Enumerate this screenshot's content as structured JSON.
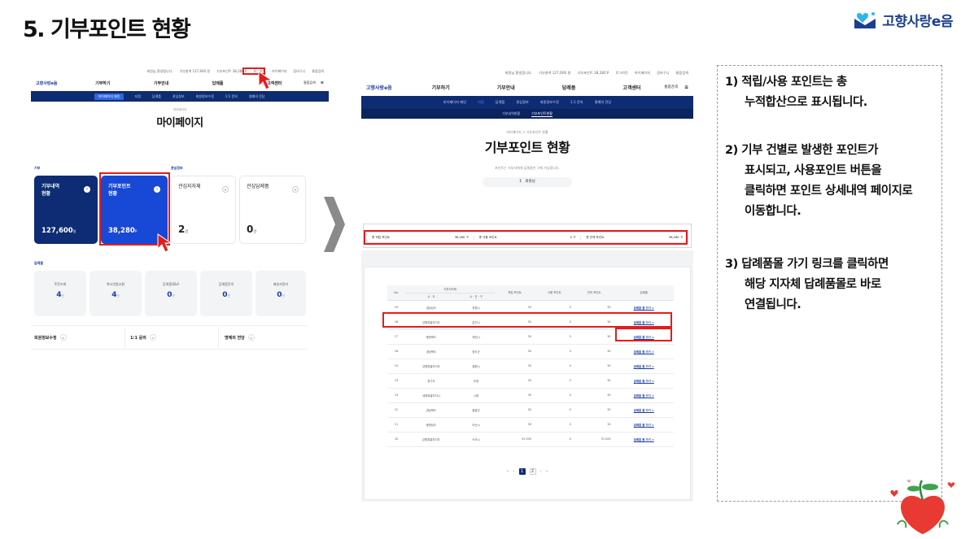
{
  "slide": {
    "title": "5. 기부포인트 현황",
    "brand": "고향사랑e음"
  },
  "left": {
    "util": [
      "회원님 환영합니다.",
      "기부총액 127,600 원",
      "기부포인트 38,280 P",
      "로그아웃",
      "마이페이지",
      "장바구니",
      "통합검색"
    ],
    "logo": "고향사랑e음",
    "menu": [
      "기부하기",
      "기부안내",
      "답례품",
      "고객센터"
    ],
    "search": "통합검색",
    "subnav": [
      "마이페이지 메인",
      "지정",
      "답례품",
      "관심정보",
      "회원정보수정",
      "1:1 문의",
      "명예의 전당"
    ],
    "crumb": "마이페이지",
    "title": "마이페이지",
    "sec_donation": "기부",
    "sec_interest": "관심정보",
    "sec_gift": "답례품",
    "cards": [
      {
        "label": "기부내역\n현황",
        "value": "127,600",
        "unit": "원"
      },
      {
        "label": "기부포인트\n현황",
        "value": "38,280",
        "unit": "P"
      },
      {
        "label": "관심지자체",
        "value": "2",
        "unit": "건"
      },
      {
        "label": "관심답례품",
        "value": "0",
        "unit": "건"
      }
    ],
    "minis": [
      {
        "label": "주문조회",
        "value": "4",
        "unit": "건"
      },
      {
        "label": "취소반품교환",
        "value": "4",
        "unit": "건"
      },
      {
        "label": "답례품Q&A",
        "value": "0",
        "unit": "건"
      },
      {
        "label": "답례품문의",
        "value": "0",
        "unit": "건"
      },
      {
        "label": "배송지관리",
        "value": "0",
        "unit": "건"
      }
    ],
    "links": [
      "회원정보수정",
      "1:1 문의",
      "명예의 전당"
    ]
  },
  "right": {
    "util": [
      "회원님 환영합니다.",
      "기부총액 127,600 원",
      "기부포인트 38,280 P",
      "로그아웃",
      "마이페이지",
      "장바구니",
      "통합검색"
    ],
    "logo": "고향사랑e음",
    "menu": [
      "기부하기",
      "기부안내",
      "답례품",
      "고객센터"
    ],
    "search": "통합검색",
    "subnav": [
      "마이페이지 메인",
      "지정",
      "답례품",
      "관심정보",
      "회원정보수정",
      "1:1 문의",
      "명예의 전당"
    ],
    "subnav2": [
      "기부내역현황",
      "기부포인트현황"
    ],
    "crumb": "마이페이지 > 기부포인트 현황",
    "title": "기부포인트 현황",
    "desc": "포인트는 기부자에게 답례품만 구매 가능합니다.",
    "user": "회원님",
    "summary": [
      {
        "label": "총 적립 포인트",
        "value": "38,280",
        "unit": "P"
      },
      {
        "label": "총 사용 포인트",
        "value": "0",
        "unit": "P"
      },
      {
        "label": "총 잔액 포인트",
        "value": "38,280",
        "unit": "P"
      }
    ],
    "table": {
      "h_no": "No.",
      "h_group": "기부지자체",
      "h_sido": "시 · 도",
      "h_sigungu": "시 · 군 · 구",
      "h_earn": "적립 포인트",
      "h_used": "사용 포인트",
      "h_bal": "잔여 포인트",
      "h_gift": "답례품",
      "go": "답례품 몰 가기 >",
      "rows": [
        [
          "19",
          "경상남도",
          "창원시",
          "30",
          "0",
          "30"
        ],
        [
          "18",
          "강원특별자치도",
          "춘천시",
          "30",
          "0",
          "30"
        ],
        [
          "17",
          "충청북도",
          "제천시",
          "30",
          "0",
          "30"
        ],
        [
          "16",
          "경상북도",
          "청도군",
          "30",
          "0",
          "30"
        ],
        [
          "15",
          "강원특별자치도",
          "철원시",
          "30",
          "0",
          "30"
        ],
        [
          "14",
          "경기도",
          "도청",
          "30",
          "0",
          "30"
        ],
        [
          "13",
          "세종특별자치시",
          "시청",
          "30",
          "0",
          "30"
        ],
        [
          "12",
          "경상북도",
          "울릉군",
          "30",
          "0",
          "30"
        ],
        [
          "11",
          "충청남도",
          "아산시",
          "30",
          "0",
          "30"
        ],
        [
          "10",
          "강원특별자치도",
          "속초시",
          "31,500",
          "0",
          "31,500"
        ]
      ]
    },
    "pager": [
      "«",
      "‹",
      "1",
      "2",
      "›",
      "»"
    ]
  },
  "notes": [
    [
      "1)  적립/사용 포인트는 총",
      "누적합산으로 표시됩니다."
    ],
    [
      "2)  기부 건별로 발생한 포인트가",
      "표시되고, 사용포인트 버튼을",
      "클릭하면 포인트 상세내역 페이지로",
      "이동합니다."
    ],
    [
      "3)  답례품몰 가기 링크를 클릭하면",
      "해당 지자체 답례품몰로 바로",
      "연결됩니다."
    ]
  ]
}
